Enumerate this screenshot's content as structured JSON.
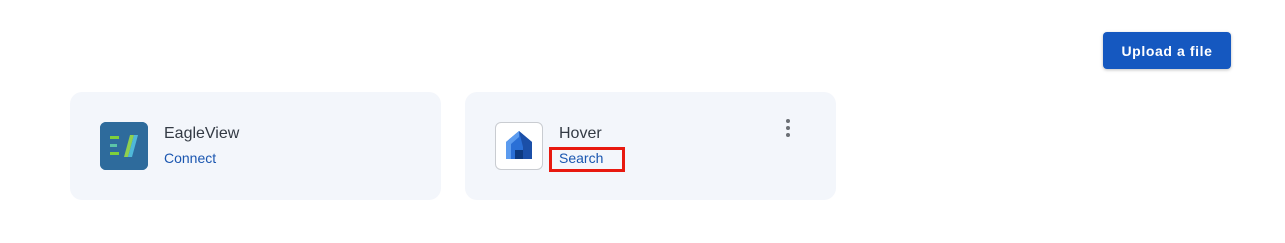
{
  "toolbar": {
    "upload_label": "Upload a file"
  },
  "integrations": [
    {
      "name": "EagleView",
      "action_label": "Connect",
      "icon": "eagleview-logo"
    },
    {
      "name": "Hover",
      "action_label": "Search",
      "icon": "hover-logo",
      "menu_icon": "more-vert-icon"
    }
  ],
  "colors": {
    "primary": "#1558c0",
    "link": "#1a56b0",
    "card_bg": "#f3f6fb",
    "highlight": "#e8190f"
  }
}
